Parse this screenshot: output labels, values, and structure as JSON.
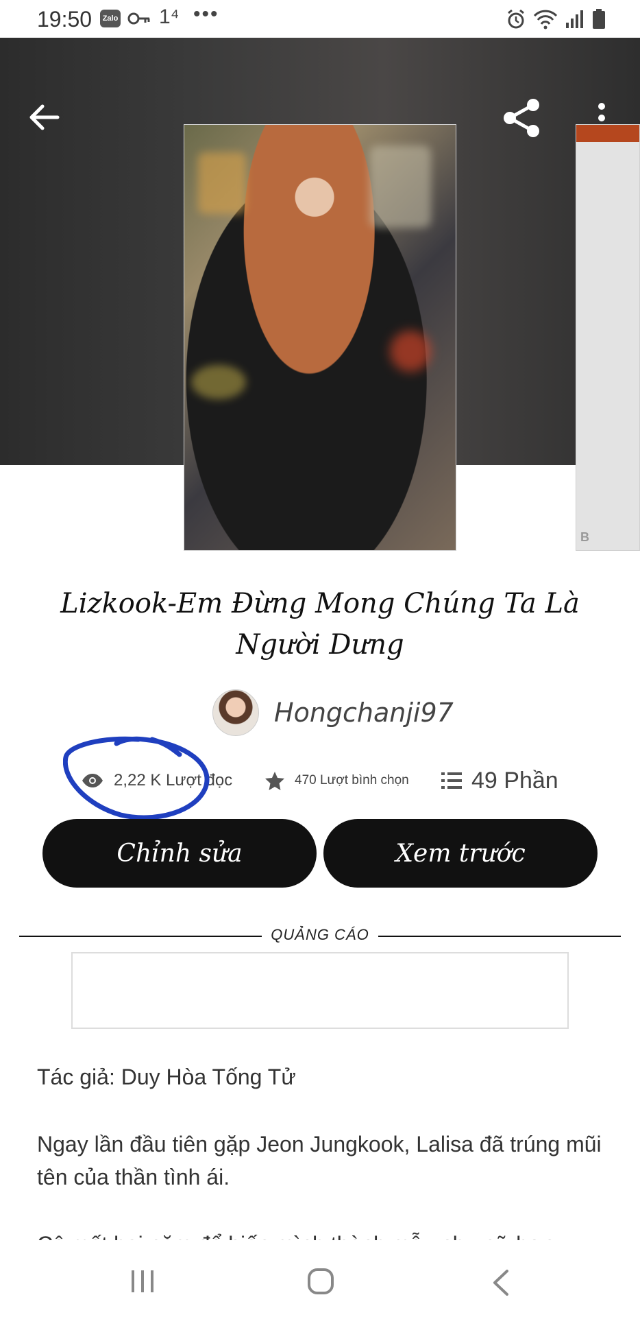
{
  "status_bar": {
    "time": "19:50",
    "zalo_label": "Zalo",
    "sim_label": "1⁴",
    "more": "•••"
  },
  "hero": {
    "side_cover_mark": "B"
  },
  "story": {
    "title": "Lizkook-Em Đừng Mong Chúng Ta Là Người Dưng",
    "author": "Hongchanji97",
    "reads": "2,22 K Lượt đọc",
    "votes": "470 Lượt bình chọn",
    "parts": "49 Phần"
  },
  "actions": {
    "edit_label": "Chỉnh sửa",
    "preview_label": "Xem trước"
  },
  "ad": {
    "label": "QUẢNG CÁO"
  },
  "description": {
    "author_line": "Tác giả: Duy Hòa Tống Tử",
    "para1": "Ngay lần đầu tiên gặp Jeon Jungkook, Lalisa đã trúng mũi tên của thần tình ái.",
    "para2": "Cô mất hai năm để biến mình thành mẫu phụ nữ hơn"
  },
  "colors": {
    "button_bg": "#111111",
    "annotation": "#1f3fbf",
    "hero_bg": "#3a3a3a"
  },
  "icons": [
    "back-icon",
    "share-icon",
    "more-vert-icon",
    "eye-icon",
    "star-icon",
    "list-icon"
  ]
}
